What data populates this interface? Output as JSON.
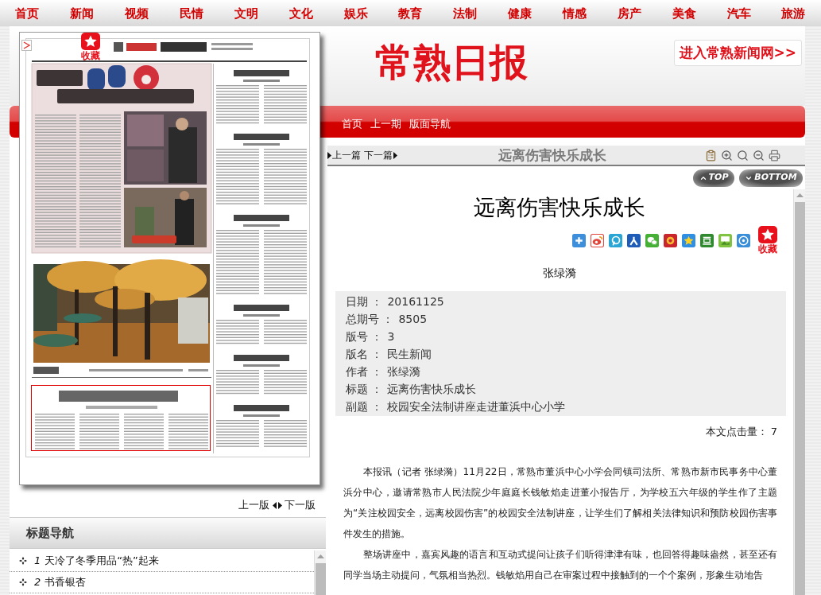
{
  "top_nav": {
    "items": [
      "首页",
      "新闻",
      "视频",
      "民情",
      "文明",
      "文化",
      "娱乐",
      "教育",
      "法制",
      "健康",
      "情感",
      "房产",
      "美食",
      "汽车",
      "旅游"
    ]
  },
  "header": {
    "logo": "常熟日报",
    "site_link": "进入常熟新闻网>>",
    "links": [
      "首页",
      "上一期",
      "版面导航"
    ]
  },
  "newspaper": {
    "favorite": "收藏"
  },
  "page_pager": {
    "prev": "上一版",
    "next": "下一版"
  },
  "title_nav": {
    "heading": "标题导航",
    "items": [
      {
        "number": "1",
        "title": "天冷了冬季用品“热”起来"
      },
      {
        "number": "2",
        "title": "书香银杏"
      }
    ]
  },
  "article_toolbar": {
    "prev": "上一篇",
    "next": "下一篇",
    "title": "远离伤害快乐成长"
  },
  "jump_buttons": [
    {
      "kind": "up",
      "label": "TOP"
    },
    {
      "kind": "down",
      "label": "BOTTOM"
    }
  ],
  "article": {
    "title": "远离伤害快乐成长",
    "favorite": "收藏",
    "author": "张绿漪",
    "info": [
      {
        "label": "日期 ：",
        "value": "20161125"
      },
      {
        "label": "总期号 ：",
        "value": "8505"
      },
      {
        "label": "版号 ：",
        "value": "3"
      },
      {
        "label": "版名 ：",
        "value": "民生新闻"
      },
      {
        "label": "作者 ：",
        "value": "张绿漪"
      },
      {
        "label": "标题 ：",
        "value": "远离伤害快乐成长"
      },
      {
        "label": "副题 ：",
        "value": "校园安全法制讲座走进董浜中心小学"
      }
    ],
    "hits": "本文点击量： 7",
    "paragraphs": [
      "本报讯（记者 张绿漪）11月22日，常熟市董浜中心小学会同镇司法所、常熟市新市民事务中心董浜分中心，邀请常熟市人民法院少年庭庭长钱敏焰走进董小报告厅，为学校五六年级的学生作了主题为“关注校园安全，远离校园伤害”的校园安全法制讲座，让学生们了解相关法律知识和预防校园伤害事件发生的措施。",
      "整场讲座中，嘉宾风趣的语言和互动式提问让孩子们听得津津有味，也回答得趣味盎然，甚至还有同学当场主动提问，气氛相当热烈。钱敏焰用自己在审案过程中接触到的一个个案例，形象生动地告"
    ]
  }
}
